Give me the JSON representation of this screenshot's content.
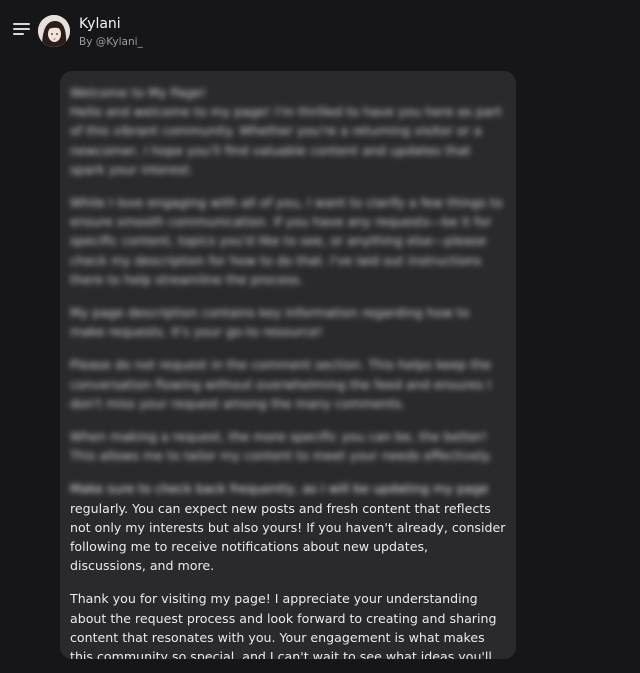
{
  "header": {
    "menu_icon": "hamburger-menu-icon",
    "title": "Kylani",
    "subtitle": "By @Kylani_",
    "avatar_icon": "avatar-image"
  },
  "description": {
    "heading": "Welcome to My Page!",
    "intro": "Hello and welcome to my page! I'm thrilled to have you here as part of this vibrant community. Whether you're a returning visitor or a newcomer, I hope you'll find valuable content and updates that spark your interest.",
    "p2": "While I love engaging with all of you, I want to clarify a few things to ensure smooth communication. If you have any requests—be it for specific content, topics you'd like to see, or anything else—please check my description for how to do that. I've laid out instructions there to help streamline the process.",
    "p3": "My page description contains key information regarding how to make requests. It's your go-to resource!",
    "p4": "Please do not request in the comment section. This helps keep the conversation flowing without overwhelming the feed and ensures I don't miss your request among the many comments.",
    "p5": "When making a request, the more specific you can be, the better! This allows me to tailor my content to meet your needs effectively.",
    "p6_blurred": "Make sure to check back frequently, as I will be updating my page",
    "p6_visible": "regularly. You can expect new posts and fresh content that reflects not only my interests but also yours! If you haven't already, consider following me to receive notifications about new updates, discussions, and more.",
    "p7": "Thank you for visiting my page! I appreciate your understanding about the request process and look forward to creating and sharing content that resonates with you. Your engagement is what makes this community so special, and I can't wait to see what ideas you'll share."
  }
}
